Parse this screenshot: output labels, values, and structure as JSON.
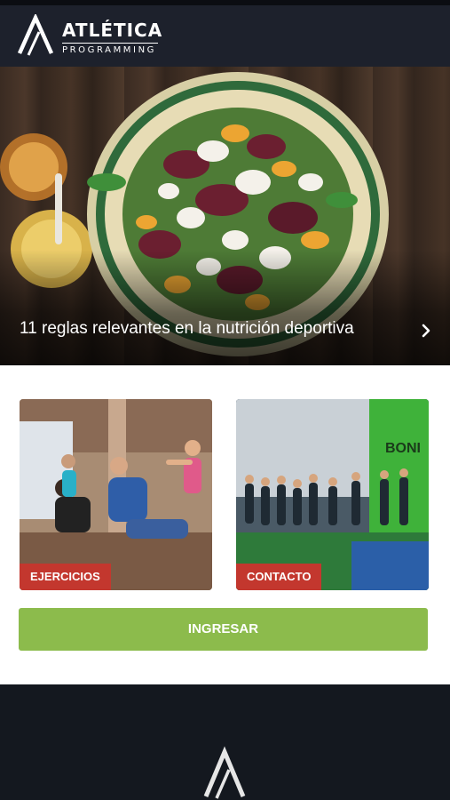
{
  "header": {
    "brand_name": "ATLÉTICA",
    "brand_sub": "PROGRAMMING",
    "logo_icon": "atletica-a-logo-icon"
  },
  "hero": {
    "title": "11 reglas relevantes en la nutrición deportiva",
    "arrow_icon": "chevron-right-icon"
  },
  "cards": [
    {
      "label": "EJERCICIOS"
    },
    {
      "label": "CONTACTO"
    }
  ],
  "actions": {
    "ingresar_label": "INGRESAR"
  },
  "colors": {
    "topbar": "#1d212c",
    "tag_red": "#c3372e",
    "button_green": "#8cbb4c",
    "footer": "#14181f"
  }
}
